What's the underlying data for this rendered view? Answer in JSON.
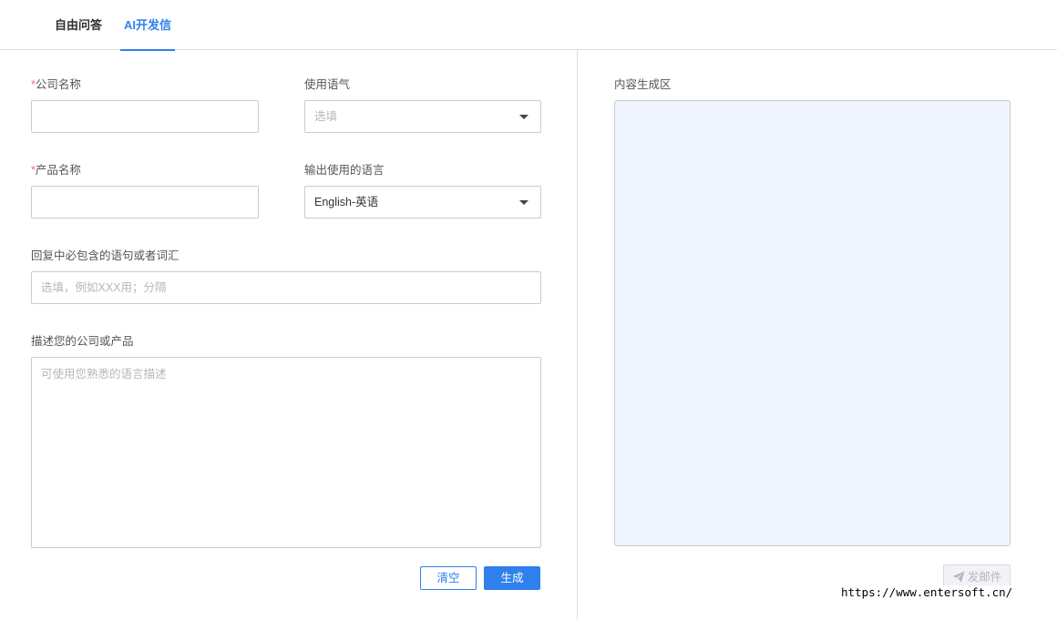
{
  "tabs": [
    {
      "label": "自由问答",
      "active": false
    },
    {
      "label": "AI开发信",
      "active": true
    }
  ],
  "form": {
    "company_name": {
      "required_mark": "*",
      "label": "公司名称",
      "value": ""
    },
    "tone": {
      "label": "使用语气",
      "placeholder": "选填"
    },
    "product_name": {
      "required_mark": "*",
      "label": "产品名称",
      "value": ""
    },
    "output_language": {
      "label": "输出使用的语言",
      "value": "English-英语"
    },
    "must_include": {
      "label": "回复中必包含的语句或者词汇",
      "placeholder": "选填，例如XXX用；分隔"
    },
    "description": {
      "label": "描述您的公司或产品",
      "placeholder": "可使用您熟悉的语言描述"
    },
    "clear_label": "清空",
    "generate_label": "生成"
  },
  "output": {
    "label": "内容生成区",
    "send_mail_label": "发邮件"
  },
  "watermark": "https://www.entersoft.cn/",
  "colors": {
    "accent": "#2f80ed",
    "required": "#f56c6c",
    "output_bg": "#eff4fd"
  }
}
